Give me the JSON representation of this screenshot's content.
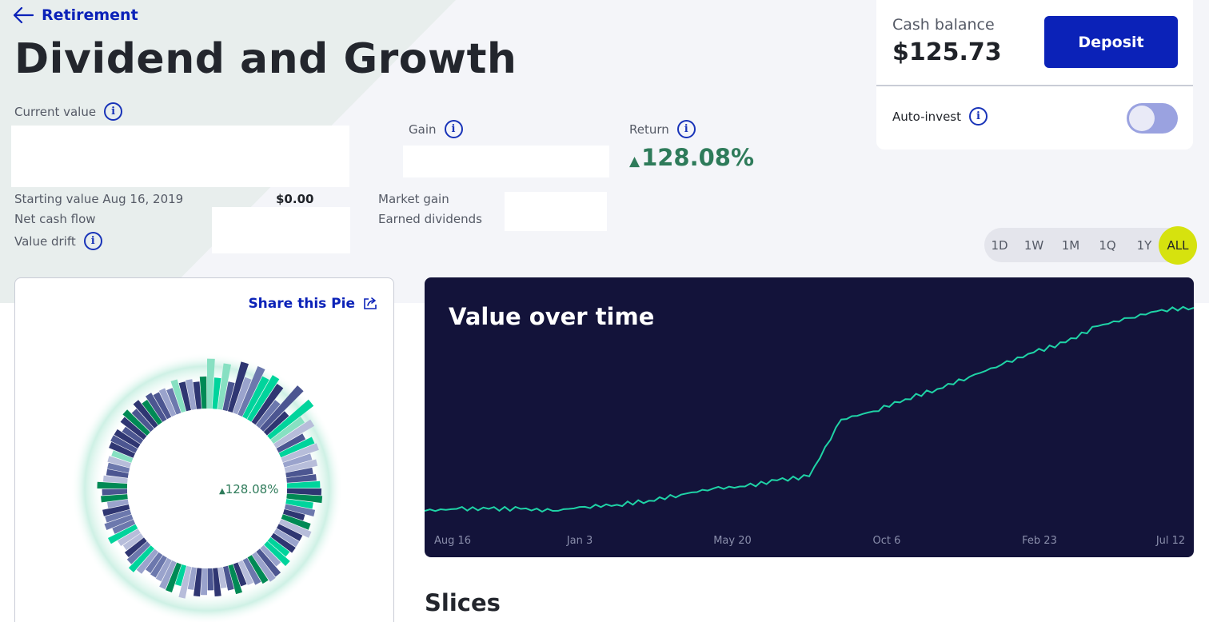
{
  "nav": {
    "back_label": "Retirement"
  },
  "page": {
    "title": "Dividend and Growth"
  },
  "stats": {
    "current_value_label": "Current value",
    "gain_label": "Gain",
    "return_label": "Return",
    "return_arrow": "▲",
    "return_value": "128.08%",
    "starting_value_label": "Starting value Aug 16, 2019",
    "starting_value": "$0.00",
    "net_cash_flow_label": "Net cash flow",
    "value_drift_label": "Value drift",
    "market_gain_label": "Market gain",
    "earned_dividends_label": "Earned dividends",
    "info_glyph": "i"
  },
  "cash": {
    "label": "Cash balance",
    "amount": "$125.73",
    "deposit_label": "Deposit",
    "autoinvest_label": "Auto-invest",
    "autoinvest_enabled": true
  },
  "time_ranges": {
    "options": [
      "1D",
      "1W",
      "1M",
      "1Q",
      "1Y",
      "ALL"
    ],
    "selected": "ALL"
  },
  "pie": {
    "share_label": "Share this Pie",
    "center_arrow": "▲",
    "center_return": "128.08%"
  },
  "chart_data": {
    "type": "line",
    "title": "Value over time",
    "x_ticks": [
      "Aug 16",
      "Jan 3",
      "May 20",
      "Oct 6",
      "Feb 23",
      "Jul 12"
    ],
    "series": [
      {
        "values": [
          0.0,
          0.01,
          0.01,
          0.01,
          0.0,
          0.02,
          0.03,
          0.05,
          0.08,
          0.11,
          0.12,
          0.15,
          0.17,
          0.45,
          0.49,
          0.55,
          0.6,
          0.66,
          0.72,
          0.78,
          0.83,
          0.91,
          0.95,
          0.99,
          1.0
        ]
      }
    ],
    "line_color": "#1fd3a6"
  },
  "colors": {
    "brand_blue": "#0b22b8",
    "accent_green": "#2e7b5a",
    "chart_bg": "#13133a",
    "range_active": "#d6e20e"
  },
  "slices": {
    "heading": "Slices"
  }
}
